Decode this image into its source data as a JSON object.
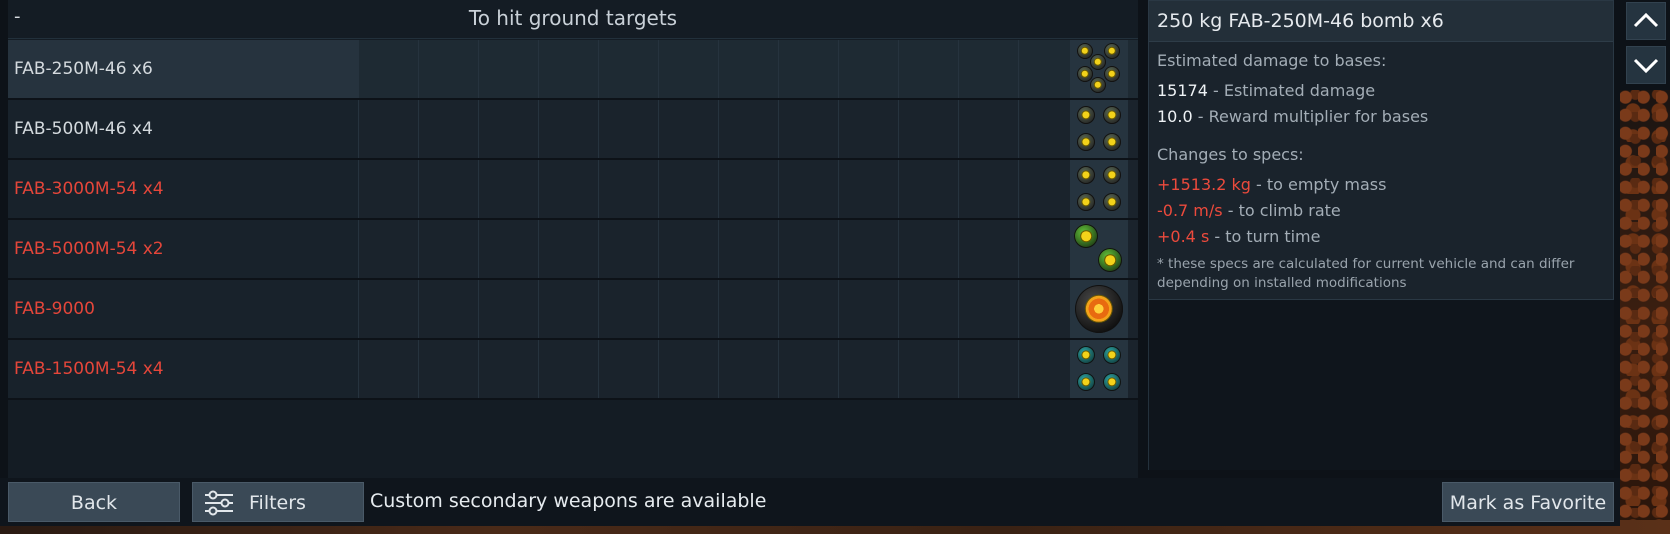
{
  "header": {
    "left_mark": "-",
    "title": "To hit ground targets"
  },
  "rows": [
    {
      "name": "FAB-250M-46 x6",
      "available": true,
      "selected": true,
      "icon": "bomb-cluster-yellow-6"
    },
    {
      "name": "FAB-500M-46 x4",
      "available": true,
      "selected": false,
      "icon": "bomb-cluster-yellow-4"
    },
    {
      "name": "FAB-3000M-54 x4",
      "available": false,
      "selected": false,
      "icon": "bomb-cluster-yellow-4-dark"
    },
    {
      "name": "FAB-5000M-54 x2",
      "available": false,
      "selected": false,
      "icon": "bomb-green-2"
    },
    {
      "name": "FAB-9000",
      "available": false,
      "selected": false,
      "icon": "bomb-large-orange"
    },
    {
      "name": "FAB-1500M-54 x4",
      "available": false,
      "selected": false,
      "icon": "bomb-cluster-teal-4"
    }
  ],
  "info": {
    "title": "250 kg FAB-250M-46 bomb x6",
    "damage_heading": "Estimated damage to bases:",
    "damage_value": "15174",
    "damage_label": " - Estimated damage",
    "reward_value": "10.0",
    "reward_label": " - Reward multiplier for bases",
    "changes_heading": "Changes to specs:",
    "changes": [
      {
        "value": "+1513.2 kg",
        "label": " - to empty mass"
      },
      {
        "value": "-0.7 m/s",
        "label": " - to climb rate"
      },
      {
        "value": "+0.4 s",
        "label": " - to turn time"
      }
    ],
    "note": "* these specs are calculated for current vehicle and can differ depending on installed modifications"
  },
  "footer": {
    "back_label": "Back",
    "filters_label": "Filters",
    "status_text": "Custom secondary weapons are available",
    "favorite_label": "Mark as Favorite"
  },
  "colors": {
    "unavailable": "#e4463a",
    "accent_panel": "#232f39"
  }
}
